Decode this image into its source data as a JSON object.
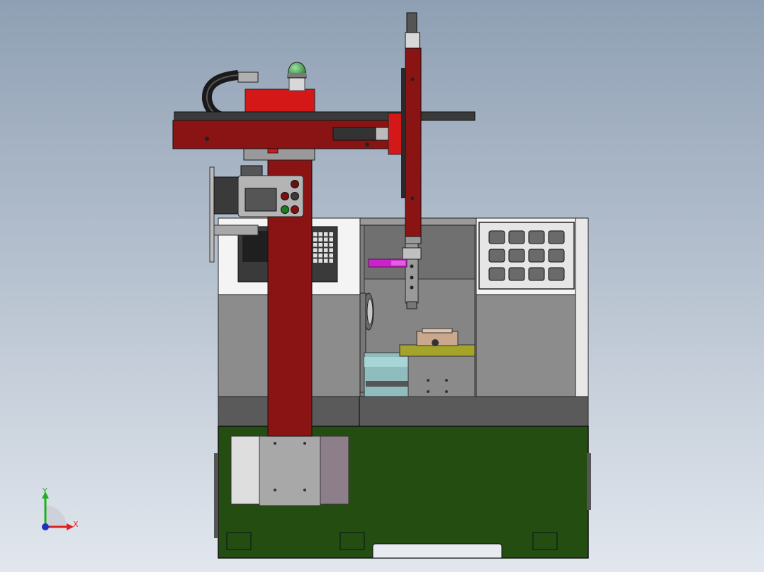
{
  "viewport": {
    "background_top": "#8fa0b4",
    "background_bottom": "#e2e7ee"
  },
  "axis_triad": {
    "x_label": "X",
    "y_label": "Y",
    "x_color": "#e02020",
    "y_color": "#20b020",
    "z_color": "#2030c0"
  },
  "colors": {
    "gantry_red": "#8a1414",
    "bright_red": "#d41818",
    "machine_white": "#f4f4f4",
    "machine_gray": "#8c8c8c",
    "machine_dark": "#5a5a5a",
    "base_green": "#244d12",
    "fixture_olive": "#a4a42a",
    "workpiece_magenta": "#cc22cc",
    "beacon_green": "#2f9f3f"
  },
  "control_panel": {
    "button_colors": [
      "#6a1010",
      "#3a3a3a",
      "#7a1010",
      "#1f7a22",
      "#8a1010"
    ]
  },
  "machine": {
    "window_cell_count": 12,
    "keypad_key_count": 24
  }
}
